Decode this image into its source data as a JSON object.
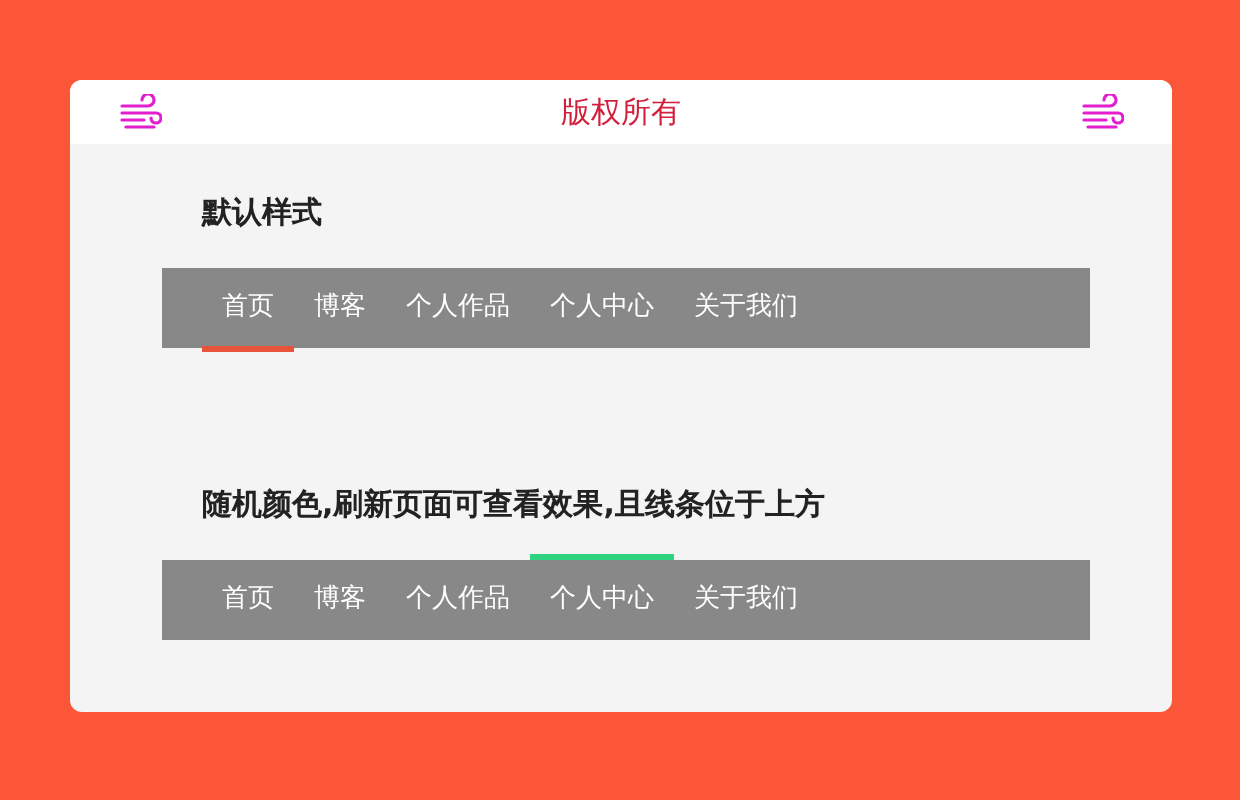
{
  "header": {
    "title": "版权所有"
  },
  "menus": [
    {
      "title": "默认样式",
      "kind": "underline",
      "items": [
        {
          "label": "首页",
          "selected": true,
          "color": "#e8543a"
        },
        {
          "label": "博客",
          "selected": false
        },
        {
          "label": "个人作品",
          "selected": false
        },
        {
          "label": "个人中心",
          "selected": false
        },
        {
          "label": "关于我们",
          "selected": false
        }
      ]
    },
    {
      "title": "随机颜色,刷新页面可查看效果,且线条位于上方",
      "kind": "overline",
      "items": [
        {
          "label": "首页",
          "selected": false
        },
        {
          "label": "博客",
          "selected": false
        },
        {
          "label": "个人作品",
          "selected": false
        },
        {
          "label": "个人中心",
          "selected": true,
          "color": "#2ed37f"
        },
        {
          "label": "关于我们",
          "selected": false
        }
      ]
    }
  ]
}
